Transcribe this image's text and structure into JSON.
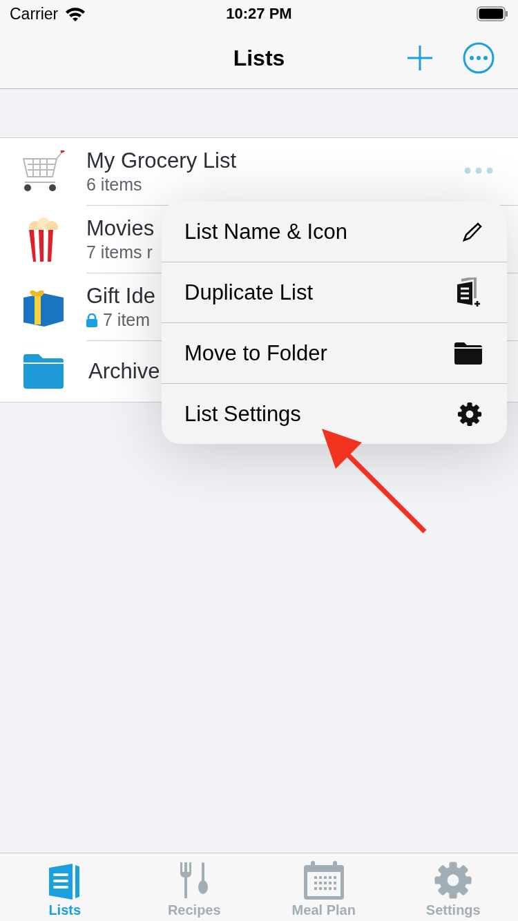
{
  "status_bar": {
    "carrier": "Carrier",
    "time": "10:27 PM"
  },
  "nav": {
    "title": "Lists"
  },
  "lists": [
    {
      "kind": "list",
      "name": "My Grocery List",
      "subtitle": "6 items",
      "locked": false,
      "more": true
    },
    {
      "kind": "list",
      "name": "Movies",
      "subtitle": "7 items r",
      "locked": false,
      "more": false
    },
    {
      "kind": "list",
      "name": "Gift Ide",
      "subtitle": "7 item",
      "locked": true,
      "more": false
    },
    {
      "kind": "folder",
      "name": "Archive",
      "locked": false,
      "more": false
    }
  ],
  "menu": [
    {
      "label": "List Name & Icon"
    },
    {
      "label": "Duplicate List"
    },
    {
      "label": "Move to Folder"
    },
    {
      "label": "List Settings"
    }
  ],
  "tabs": [
    {
      "label": "Lists",
      "selected": true
    },
    {
      "label": "Recipes",
      "selected": false
    },
    {
      "label": "Meal Plan",
      "selected": false
    },
    {
      "label": "Settings",
      "selected": false
    }
  ]
}
